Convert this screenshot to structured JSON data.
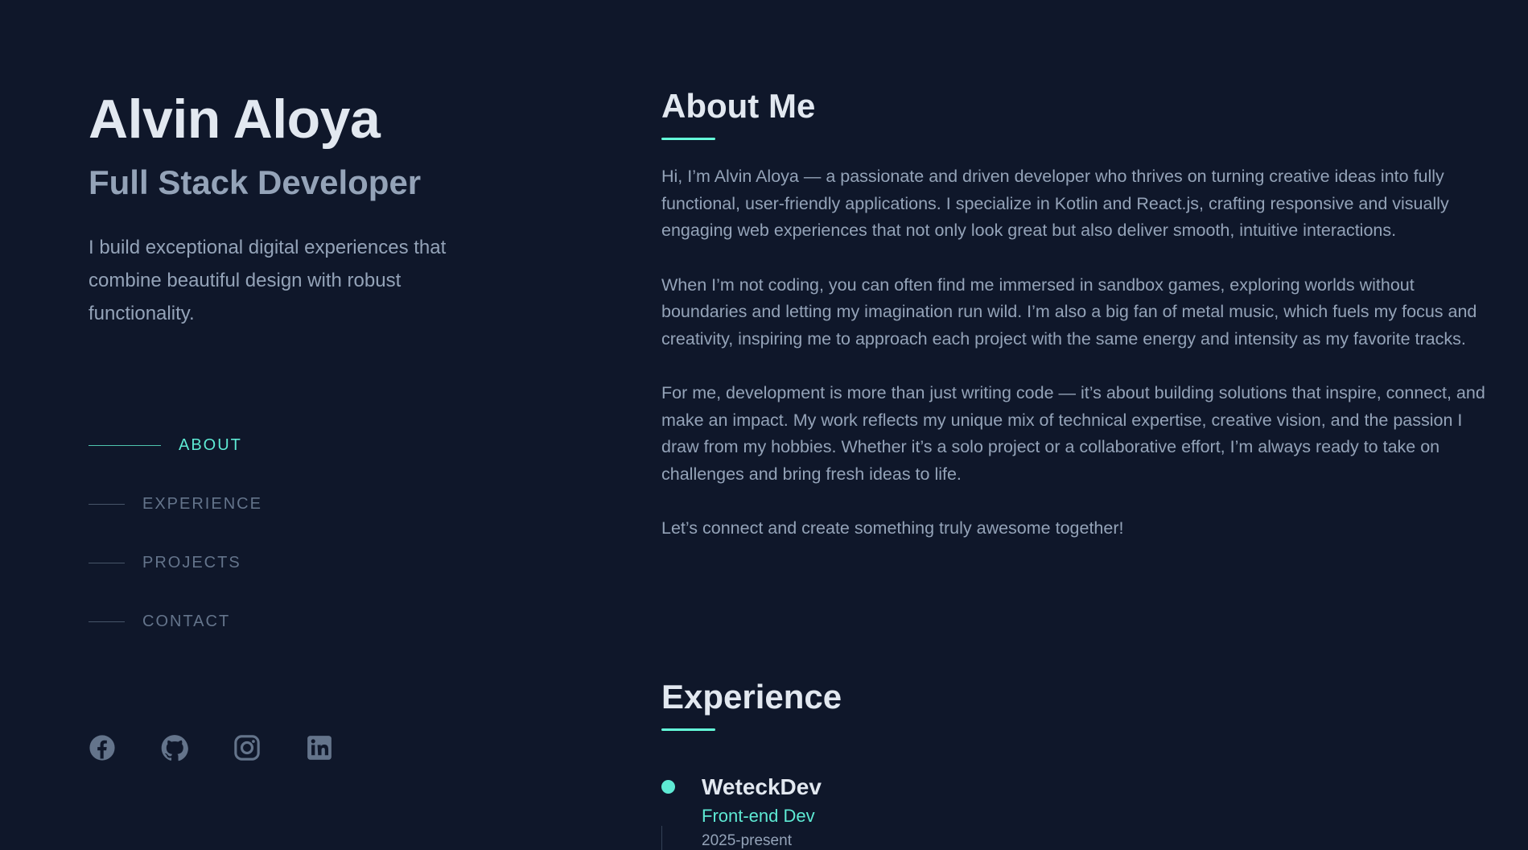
{
  "profile": {
    "name": "Alvin Aloya",
    "role": "Full Stack Developer",
    "intro": "I build exceptional digital experiences that combine beautiful design with robust functionality."
  },
  "nav": {
    "items": [
      {
        "label": "ABOUT",
        "active": true
      },
      {
        "label": "EXPERIENCE",
        "active": false
      },
      {
        "label": "PROJECTS",
        "active": false
      },
      {
        "label": "CONTACT",
        "active": false
      }
    ]
  },
  "socials": [
    {
      "icon": "facebook-icon"
    },
    {
      "icon": "github-icon"
    },
    {
      "icon": "instagram-icon"
    },
    {
      "icon": "linkedin-icon"
    }
  ],
  "about": {
    "title": "About Me",
    "paragraphs": [
      "Hi, I’m Alvin Aloya — a passionate and driven developer who thrives on turning creative ideas into fully functional, user-friendly applications. I specialize in Kotlin and React.js, crafting responsive and visually engaging web experiences that not only look great but also deliver smooth, intuitive interactions.",
      "When I’m not coding, you can often find me immersed in sandbox games, exploring worlds without boundaries and letting my imagination run wild. I’m also a big fan of metal music, which fuels my focus and creativity, inspiring me to approach each project with the same energy and intensity as my favorite tracks.",
      "For me, development is more than just writing code — it’s about building solutions that inspire, connect, and make an impact. My work reflects my unique mix of technical expertise, creative vision, and the passion I draw from my hobbies. Whether it’s a solo project or a collaborative effort, I’m always ready to take on challenges and bring fresh ideas to life.",
      "Let’s connect and create something truly awesome together!"
    ]
  },
  "experience": {
    "title": "Experience",
    "jobs": [
      {
        "company": "WeteckDev",
        "role": "Front-end Dev",
        "dates": "2025-present"
      }
    ]
  },
  "colors": {
    "background": "#0f172a",
    "accent": "#64ffda",
    "heading": "#e2e8f0",
    "muted": "#94a3b8"
  }
}
